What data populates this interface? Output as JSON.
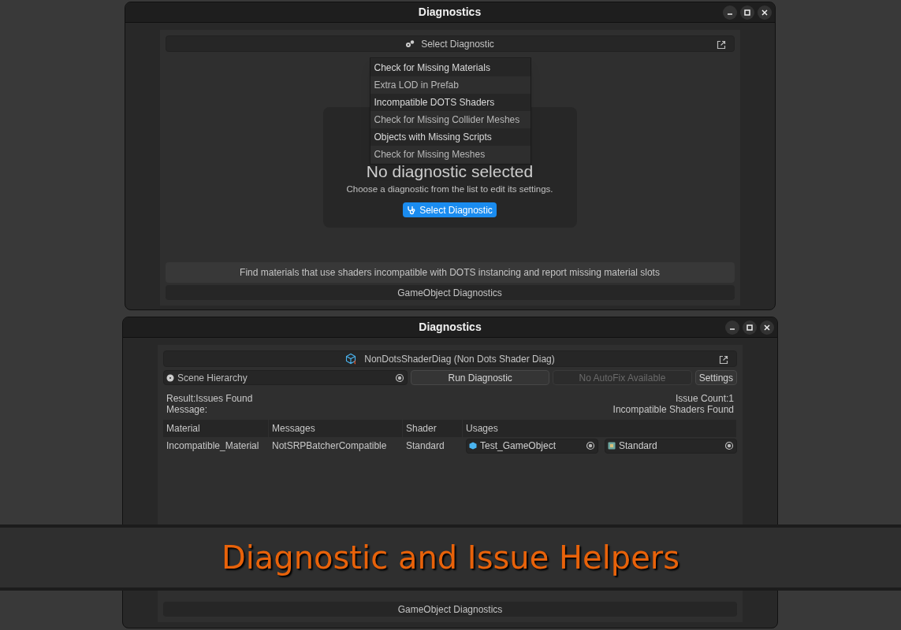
{
  "window_top": {
    "title": "Diagnostics",
    "header": "Select Diagnostic",
    "dropdown": [
      "Check for Missing Materials",
      "Extra LOD in Prefab",
      "Incompatible DOTS Shaders",
      "Check for Missing Collider Meshes",
      "Objects with Missing Scripts",
      "Check for Missing Meshes"
    ],
    "empty_title": "No diagnostic selected",
    "empty_text": "Choose a diagnostic from the list to edit its settings.",
    "empty_button": "Select Diagnostic",
    "description": "Find materials that use shaders incompatible with DOTS instancing and report missing material slots",
    "footer": "GameObject Diagnostics"
  },
  "window_bottom": {
    "title": "Diagnostics",
    "header": "NonDotsShaderDiag (Non Dots Shader Diag)",
    "scope_field": "Scene Hierarchy",
    "buttons": [
      {
        "label": "Run Diagnostic",
        "disabled": false
      },
      {
        "label": "No AutoFix Available",
        "disabled": true
      },
      {
        "label": "Settings",
        "disabled": false
      }
    ],
    "result": "Result:Issues Found",
    "message": "Message:",
    "issue_count": "Issue Count:1",
    "issue_message": "Incompatible Shaders Found",
    "table": {
      "columns": [
        "Material",
        "Messages",
        "Shader",
        "Usages"
      ],
      "rows": [
        {
          "material": "Incompatible_Material",
          "messages": "NotSRPBatcherCompatible",
          "shader": "Standard",
          "usages": [
            {
              "kind": "gameobject",
              "label": "Test_GameObject"
            },
            {
              "kind": "shader",
              "label": "Standard"
            }
          ]
        }
      ]
    },
    "footer": "GameObject Diagnostics"
  },
  "banner": {
    "title": "Diagnostic and Issue Helpers"
  }
}
